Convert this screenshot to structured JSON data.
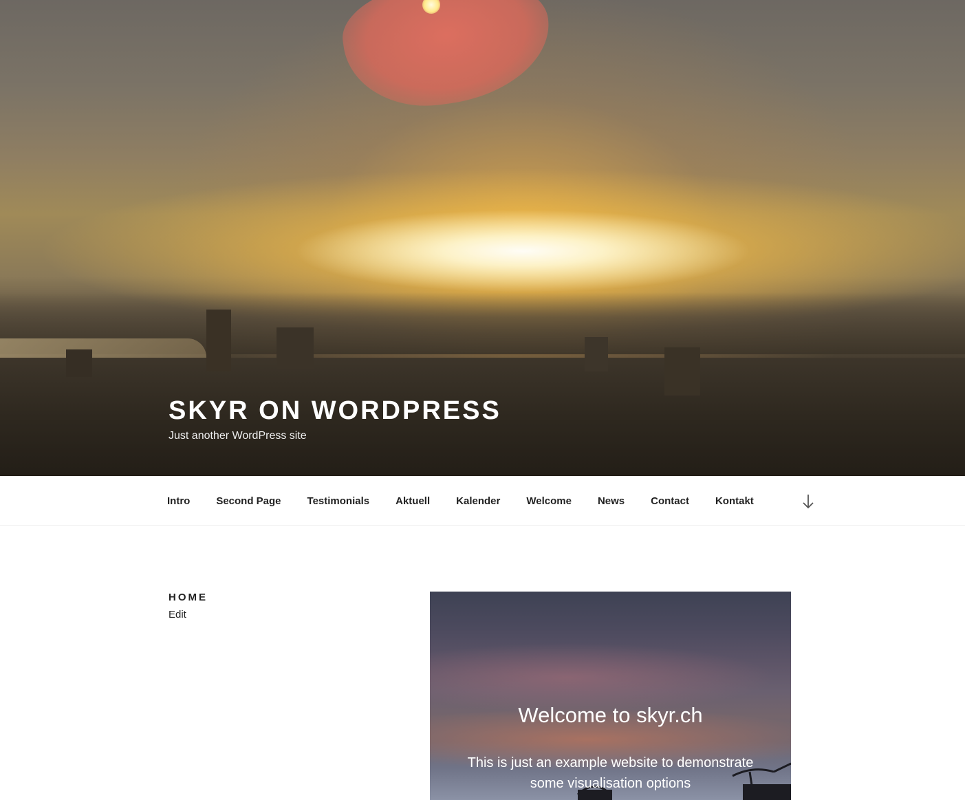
{
  "site": {
    "title": "SKYR ON WORDPRESS",
    "description": "Just another WordPress site"
  },
  "nav": {
    "items": [
      {
        "label": "Intro"
      },
      {
        "label": "Second Page"
      },
      {
        "label": "Testimonials"
      },
      {
        "label": "Aktuell"
      },
      {
        "label": "Kalender"
      },
      {
        "label": "Welcome"
      },
      {
        "label": "News"
      },
      {
        "label": "Contact"
      },
      {
        "label": "Kontakt"
      }
    ],
    "scroll_icon": "arrow-down-icon"
  },
  "page": {
    "title": "HOME",
    "edit_label": "Edit"
  },
  "cover": {
    "title": "Welcome to skyr.ch",
    "text": "This is just an example website to demonstrate some visualisation options"
  },
  "colors": {
    "text": "#222222",
    "nav_border": "#eeeeee",
    "hero_title": "#ffffff"
  }
}
